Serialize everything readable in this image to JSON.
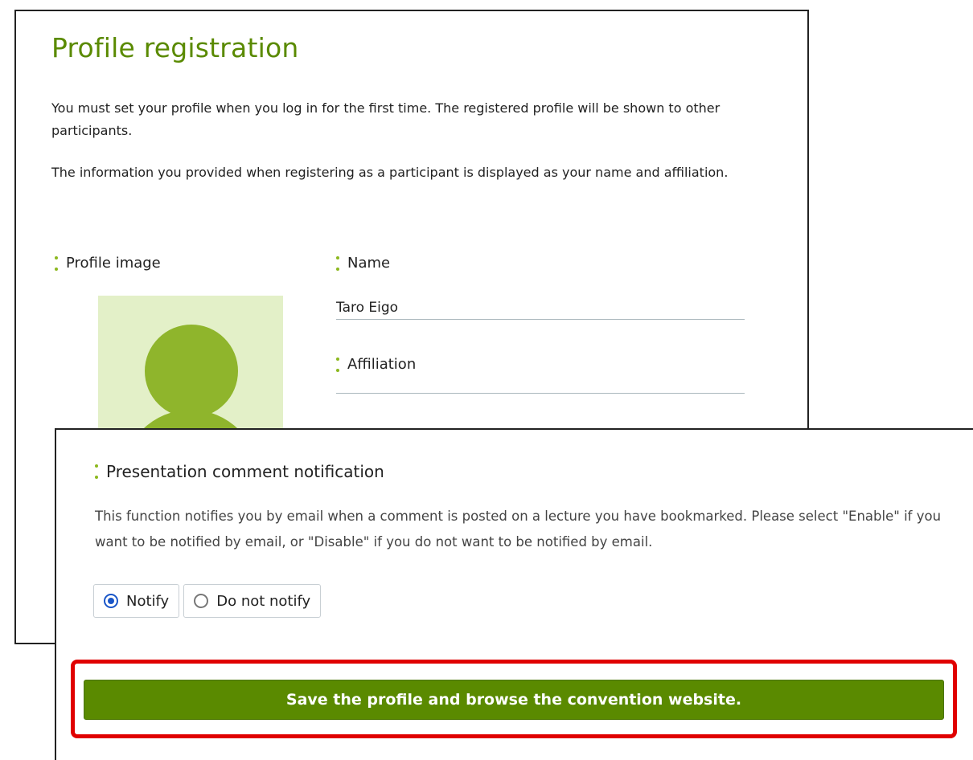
{
  "page": {
    "title": "Profile registration",
    "intro": [
      "You must set your profile when you log in for the first time. The registered profile will be shown to other participants.",
      "The information you provided when registering as a participant is displayed as your name and affiliation."
    ]
  },
  "profile": {
    "image_label": "Profile image",
    "avatar_icon": "user-avatar-icon",
    "name_label": "Name",
    "name_value": "Taro Eigo",
    "affiliation_label": "Affiliation",
    "affiliation_value": ""
  },
  "notification": {
    "label": "Presentation comment notification",
    "description": "This function notifies you by email when a comment is posted on a lecture you have bookmarked. Please select \"Enable\" if you want to be notified by email, or \"Disable\" if you do not want to be notified by email.",
    "options": [
      {
        "label": "Notify",
        "checked": true
      },
      {
        "label": "Do not notify",
        "checked": false
      }
    ]
  },
  "actions": {
    "save_label": "Save the profile and browse the convention website."
  },
  "colors": {
    "accent": "#5a8a00",
    "label_marker": "#8cb81e",
    "avatar_bg": "#e3f0c8",
    "avatar_fg": "#8fb52c",
    "highlight": "#e00000",
    "radio_checked": "#1a56c8"
  }
}
